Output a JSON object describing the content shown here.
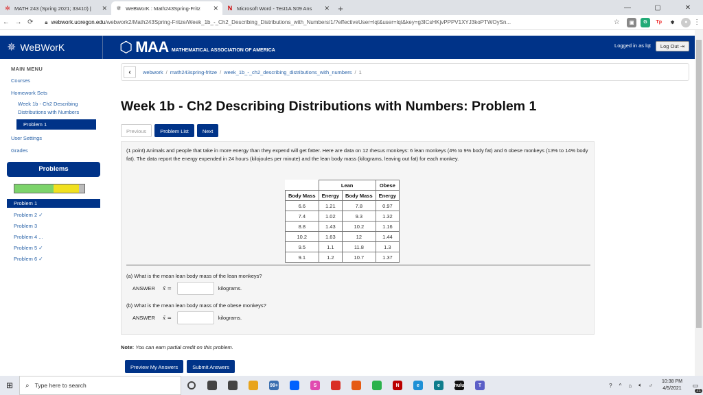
{
  "browser": {
    "tabs": [
      {
        "title": "MATH 243 (Spring 2021; 33410) | ",
        "icon": "ww-gear-icon",
        "color": "#d33"
      },
      {
        "title": "WeBWorK : Math243Spring-Fritz",
        "icon": "ww-star-icon",
        "color": "#666"
      },
      {
        "title": "Microsoft Word - Test1A S09 Ans",
        "icon": "n-icon",
        "color": "#c00"
      }
    ],
    "url_domain": "webwork.uoregon.edu",
    "url_rest": "/webwork2/Math243Spring-Fritze/Week_1b_-_Ch2_Describing_Distributions_with_Numbers/1/?effectiveUser=lqt&user=lqt&key=g3ICsHKjvPPPV1XYJ3koPTWOySn...",
    "extensions": [
      {
        "label": "G",
        "color": "#2a7"
      },
      {
        "label": "Tp",
        "color": "#e22"
      }
    ]
  },
  "header": {
    "app_name": "WeBWorK",
    "maa_big": "MAA",
    "maa_small": "MATHEMATICAL ASSOCIATION OF AMERICA",
    "logged_in": "Logged in as lqt",
    "logout": "Log Out"
  },
  "sidebar": {
    "main_menu": "MAIN MENU",
    "courses": "Courses",
    "homework_sets": "Homework Sets",
    "current_set": "Week 1b - Ch2 Describing Distributions with Numbers",
    "current_problem": "Problem 1",
    "user_settings": "User Settings",
    "grades": "Grades",
    "problems_title": "Problems",
    "progress": {
      "correct": 0.56,
      "partial": 0.36
    },
    "problems": [
      {
        "label": "Problem 1"
      },
      {
        "label": "Problem 2 ✓"
      },
      {
        "label": "Problem 3"
      },
      {
        "label": "Problem 4 ..."
      },
      {
        "label": "Problem 5 ✓"
      },
      {
        "label": "Problem 6 ✓"
      }
    ]
  },
  "breadcrumb": {
    "items": [
      "webwork",
      "math243spring-fritze",
      "week_1b_-_ch2_describing_distributions_with_numbers"
    ],
    "current": "1"
  },
  "main": {
    "title": "Week 1b - Ch2 Describing Distributions with Numbers: Problem 1",
    "prev": "Previous",
    "problem_list": "Problem List",
    "next": "Next"
  },
  "problem": {
    "intro": "(1 point) Animals and people that take in more energy than they expend will get fatter. Here are data on 12 rhesus monkeys: 6 lean monkeys (4% to 9% body fat) and 6 obese monkeys (13% to 14% body fat). The data report the energy expended in 24 hours (kilojoules per minute) and the lean body mass (kilograms, leaving out fat) for each monkey.",
    "table": {
      "group_headers": [
        "Lean",
        "Obese"
      ],
      "columns": [
        "Body Mass",
        "Energy",
        "Body Mass",
        "Energy"
      ],
      "rows": [
        [
          "6.6",
          "1.21",
          "7.8",
          "0.97"
        ],
        [
          "7.4",
          "1.02",
          "9.3",
          "1.32"
        ],
        [
          "8.8",
          "1.43",
          "10.2",
          "1.16"
        ],
        [
          "10.2",
          "1.63",
          "12",
          "1.44"
        ],
        [
          "9.5",
          "1.1",
          "11.8",
          "1.3"
        ],
        [
          "9.1",
          "1.2",
          "10.7",
          "1.37"
        ]
      ]
    },
    "qa": "(a) What is the mean lean body mass of the lean monkeys?",
    "qb": "(b) What is the mean lean body mass of the obese monkeys?",
    "answer_label": "ANSWER",
    "xbar": "x̄ =",
    "unit": "kilograms.",
    "answer_a": "",
    "answer_b": ""
  },
  "footer": {
    "note_label": "Note:",
    "note_text": "You can earn partial credit on this problem.",
    "preview": "Preview My Answers",
    "submit": "Submit Answers"
  },
  "taskbar": {
    "search_placeholder": "Type here to search",
    "time": "10:38 PM",
    "date": "4/5/2021",
    "notif_count": "21",
    "apps": [
      {
        "label": "",
        "color": "#444"
      },
      {
        "label": "",
        "color": "#444"
      },
      {
        "label": "",
        "color": "#e8a41d"
      },
      {
        "label": "99+",
        "color": "#3a6fb0"
      },
      {
        "label": "",
        "color": "#0061fe"
      },
      {
        "label": "S",
        "color": "#e04ab0"
      },
      {
        "label": "",
        "color": "#d93025"
      },
      {
        "label": "",
        "color": "#e55b13"
      },
      {
        "label": "",
        "color": "#2bb24c"
      },
      {
        "label": "N",
        "color": "#b00"
      },
      {
        "label": "e",
        "color": "#1e90d6"
      },
      {
        "label": "e",
        "color": "#0f7d8c"
      },
      {
        "label": "hulu",
        "color": "#111"
      },
      {
        "label": "T",
        "color": "#5b5fc7"
      }
    ]
  }
}
